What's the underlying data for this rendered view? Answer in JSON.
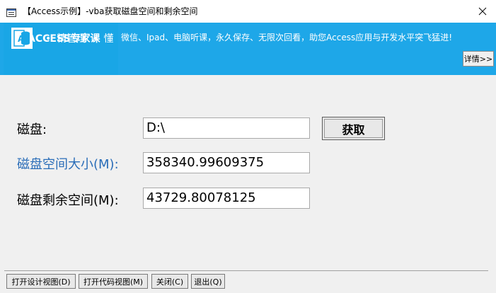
{
  "window": {
    "title": "【Access示例】-vba获取磁盘空间和剩余空间"
  },
  "banner": {
    "brand": "ACCESS专家课",
    "menu": [
      "精管理",
      "懂"
    ],
    "marquee": "微信、Ipad、电脑听课，永久保存、无限次回看，助您Access应用与开发水平突飞猛进!",
    "details_label": "详情>>"
  },
  "form": {
    "disk_label": "磁盘:",
    "disk_value": "D:\\",
    "get_button_label": "获取",
    "size_label": "磁盘空间大小(M):",
    "size_value": "358340.99609375",
    "free_label": "磁盘剩余空间(M):",
    "free_value": "43729.80078125"
  },
  "footer": {
    "design_view_label": "打开设计视图(D)",
    "code_view_label": "打开代码视图(M)",
    "close_label": "关闭(C)",
    "exit_label": "退出(Q)"
  },
  "colors": {
    "banner_blue": "#1ea7e8",
    "label_blue": "#2a6db8"
  }
}
